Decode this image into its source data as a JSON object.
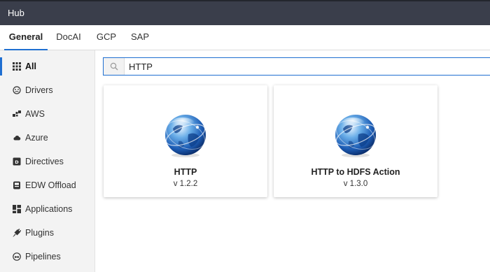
{
  "app": {
    "title": "Hub"
  },
  "tabs": [
    {
      "label": "General",
      "active": true
    },
    {
      "label": "DocAI"
    },
    {
      "label": "GCP"
    },
    {
      "label": "SAP"
    }
  ],
  "sidebar": {
    "items": [
      {
        "label": "All",
        "icon": "grid-icon",
        "active": true
      },
      {
        "label": "Drivers",
        "icon": "driver-icon"
      },
      {
        "label": "AWS",
        "icon": "aws-icon"
      },
      {
        "label": "Azure",
        "icon": "cloud-icon"
      },
      {
        "label": "Directives",
        "icon": "directive-icon"
      },
      {
        "label": "EDW Offload",
        "icon": "database-icon"
      },
      {
        "label": "Applications",
        "icon": "applications-icon"
      },
      {
        "label": "Plugins",
        "icon": "plug-icon"
      },
      {
        "label": "Pipelines",
        "icon": "pipeline-icon"
      }
    ]
  },
  "search": {
    "value": "HTTP",
    "icon": "search-icon"
  },
  "cards": [
    {
      "name": "HTTP",
      "version": "v 1.2.2",
      "icon": "globe-icon"
    },
    {
      "name": "HTTP to HDFS Action",
      "version": "v 1.3.0",
      "icon": "globe-icon"
    }
  ],
  "colors": {
    "titlebar": "#3a3e4b",
    "accent": "#1f6fd1",
    "sidebar_bg": "#f3f3f3"
  }
}
